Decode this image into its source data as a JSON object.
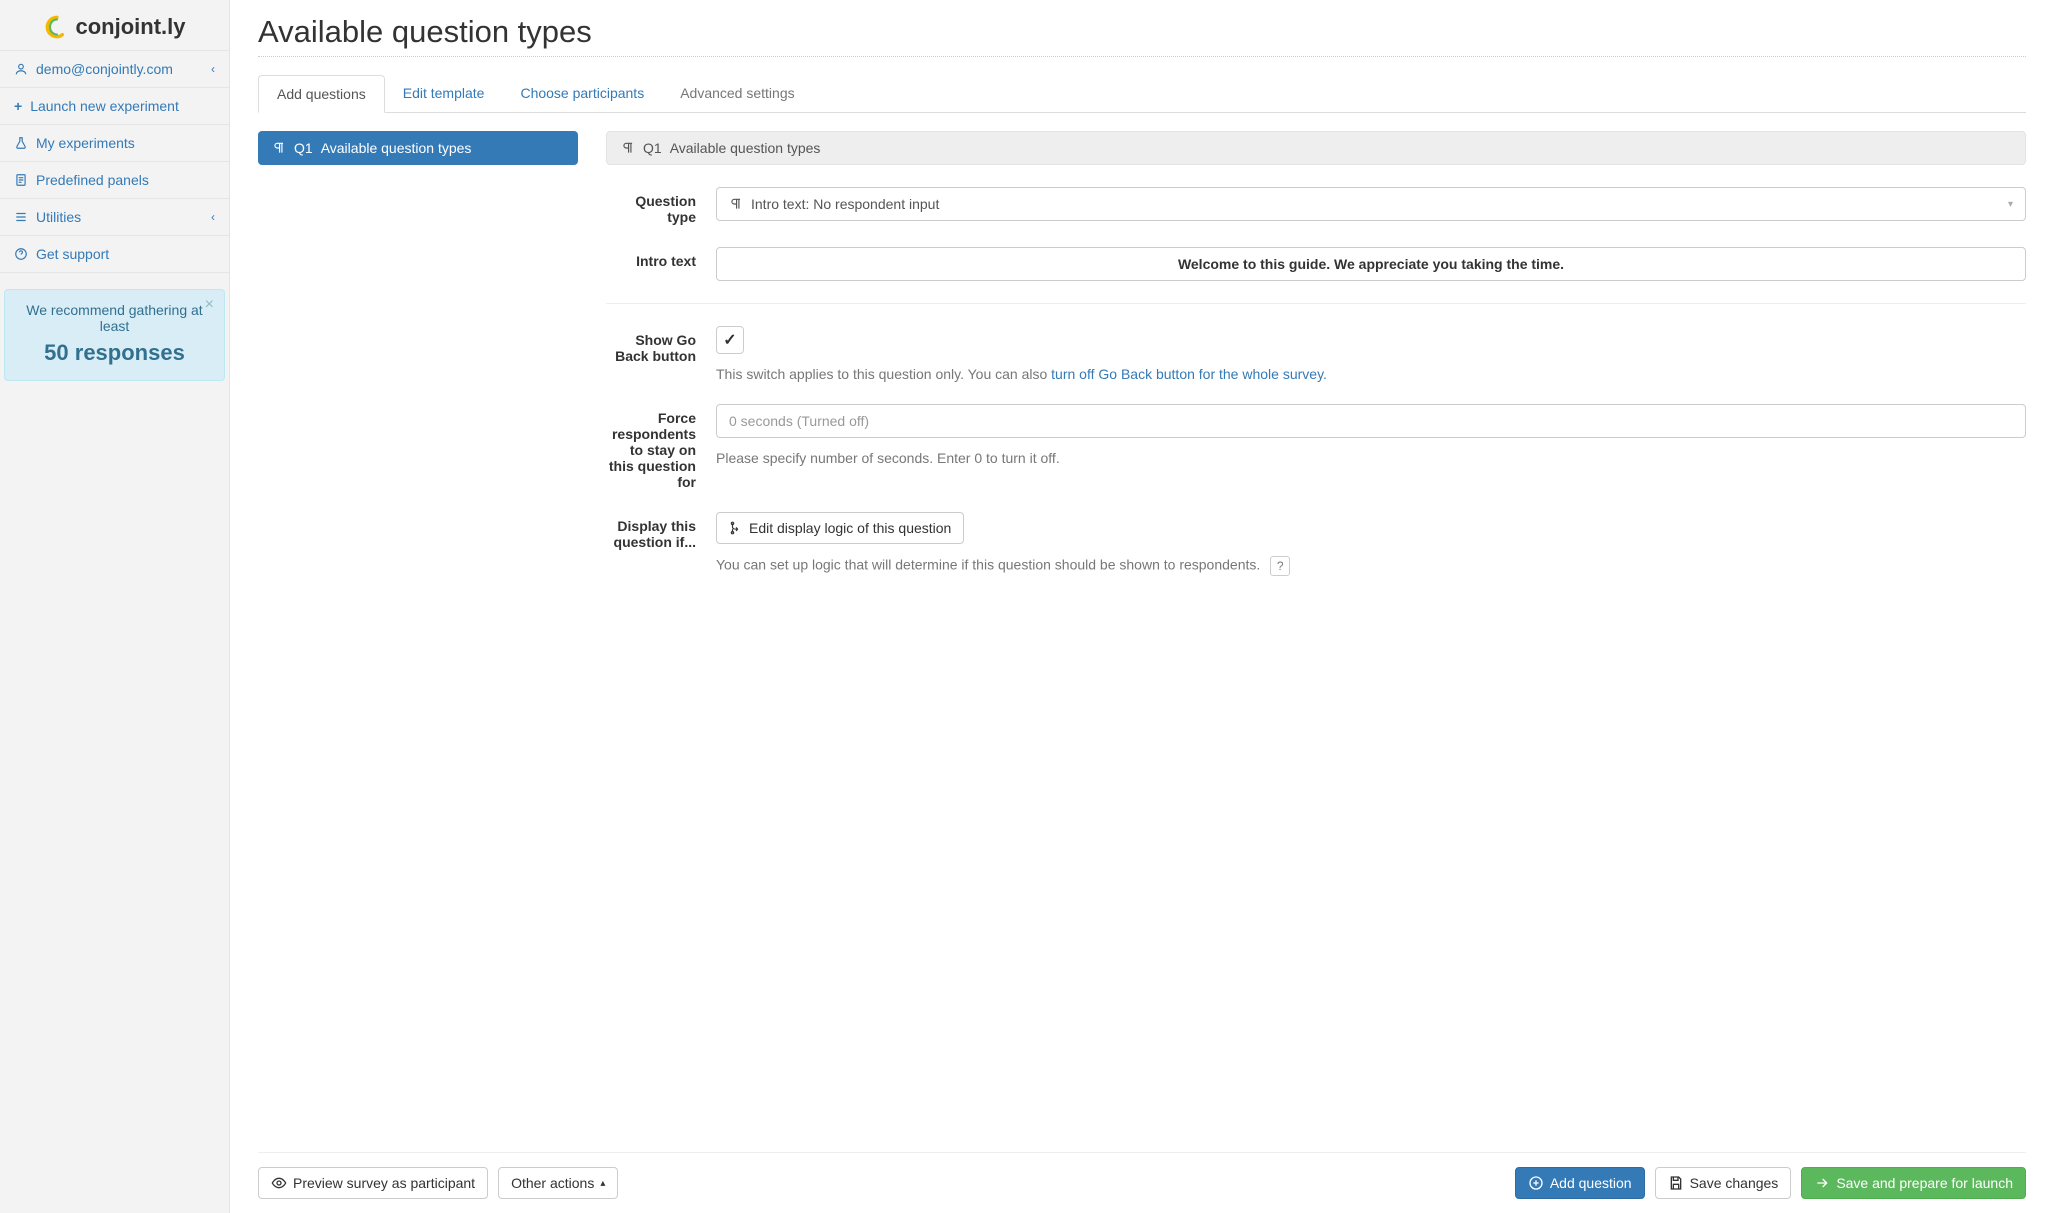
{
  "brand": "conjoint.ly",
  "sidebar": {
    "user_email": "demo@conjointly.com",
    "items": [
      {
        "label": "Launch new experiment"
      },
      {
        "label": "My experiments"
      },
      {
        "label": "Predefined panels"
      },
      {
        "label": "Utilities"
      },
      {
        "label": "Get support"
      }
    ]
  },
  "alert": {
    "line1": "We recommend gathering at least",
    "big": "50 responses"
  },
  "page_title": "Available question types",
  "tabs": [
    {
      "label": "Add questions",
      "active": true
    },
    {
      "label": "Edit template"
    },
    {
      "label": "Choose participants"
    },
    {
      "label": "Advanced settings",
      "muted": true
    }
  ],
  "question_list": {
    "item_code": "Q1",
    "item_label": "Available question types"
  },
  "detail": {
    "header_code": "Q1",
    "header_label": "Available question types",
    "labels": {
      "question_type": "Question type",
      "intro_text": "Intro text",
      "go_back": "Show Go Back button",
      "force_stay": "Force respondents to stay on this question for",
      "display_if": "Display this question if..."
    },
    "question_type_value": "Intro text: No respondent input",
    "intro_text_value": "Welcome to this guide. We appreciate you taking the time.",
    "go_back_checked": "✓",
    "go_back_help_prefix": "This switch applies to this question only. You can also ",
    "go_back_help_link": "turn off Go Back button for the whole survey.",
    "force_stay_placeholder": "0 seconds (Turned off)",
    "force_stay_help": "Please specify number of seconds. Enter 0 to turn it off.",
    "edit_logic_btn": "Edit display logic of this question",
    "display_if_help": "You can set up logic that will determine if this question should be shown to respondents."
  },
  "bottom_bar": {
    "preview": "Preview survey as participant",
    "other_actions": "Other actions",
    "add_question": "Add question",
    "save_changes": "Save changes",
    "save_launch": "Save and prepare for launch"
  }
}
